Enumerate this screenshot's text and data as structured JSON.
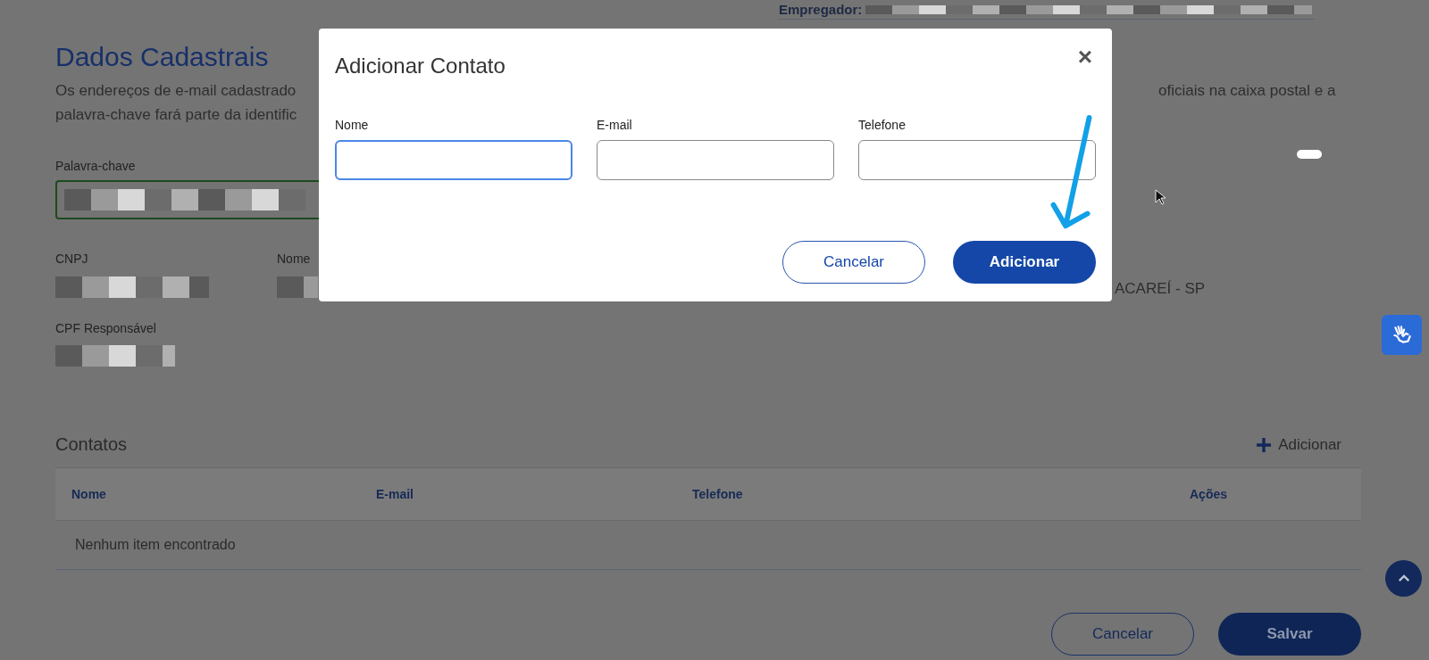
{
  "page": {
    "employer_label": "Empregador:",
    "title": "Dados Cadastrais",
    "description_left": [
      "Os endereços de e-mail cadastrado",
      "palavra-chave fará parte da identific"
    ],
    "description_right": "oficiais na caixa postal e a",
    "keyword_label": "Palavra-chave",
    "cnpj_label": "CNPJ",
    "name_label": "Nome",
    "city": "ACAREÍ - SP",
    "cpf_label": "CPF Responsável",
    "contacts": {
      "title": "Contatos",
      "add_label": "Adicionar",
      "columns": [
        "Nome",
        "E-mail",
        "Telefone",
        "Ações"
      ],
      "empty": "Nenhum item encontrado"
    },
    "buttons": [
      {
        "label": "Cancelar",
        "kind": "secondary"
      },
      {
        "label": "Salvar",
        "kind": "primary"
      }
    ]
  },
  "modal": {
    "title": "Adicionar Contato",
    "close": "×",
    "fields": [
      {
        "label": "Nome",
        "focused": true
      },
      {
        "label": "E-mail",
        "focused": false
      },
      {
        "label": "Telefone",
        "focused": false
      }
    ],
    "buttons": [
      {
        "label": "Cancelar",
        "kind": "secondary"
      },
      {
        "label": "Adicionar",
        "kind": "primary"
      }
    ]
  }
}
